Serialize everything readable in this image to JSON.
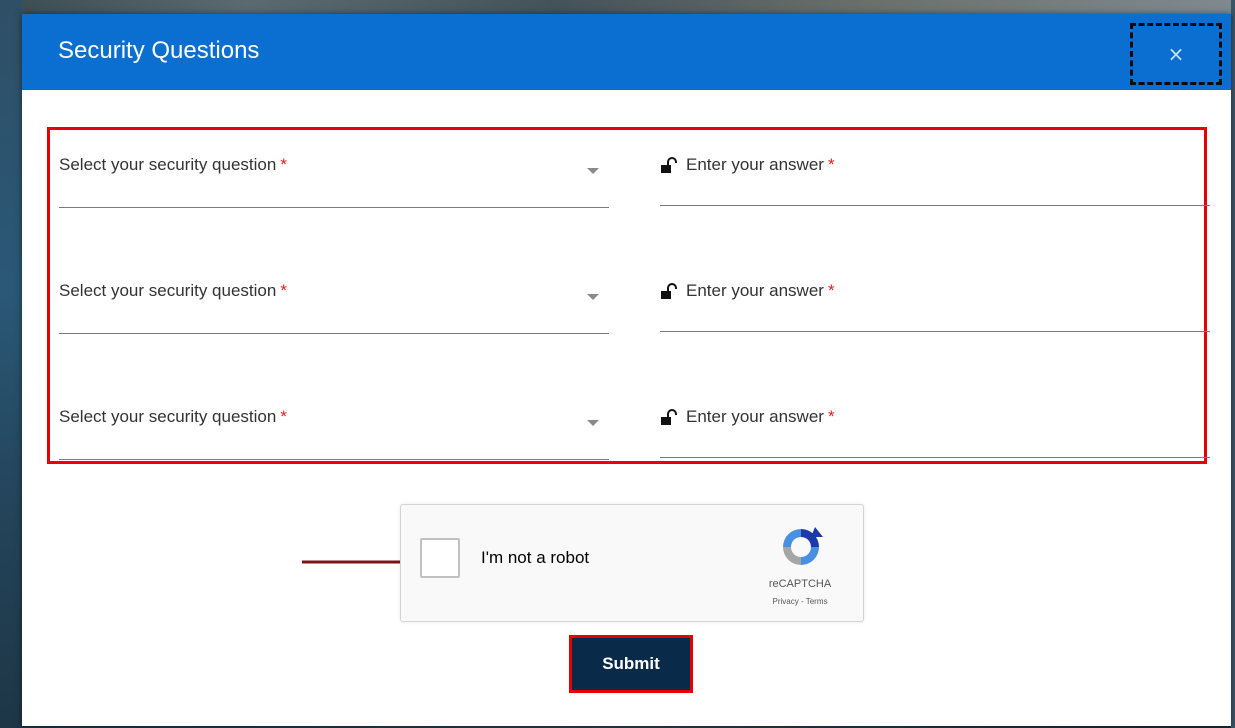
{
  "dialog": {
    "title": "Security Questions",
    "close_label": "×"
  },
  "questions": [
    {
      "select_placeholder": "Select your security question",
      "answer_placeholder": "Enter your answer",
      "required_mark": "*"
    },
    {
      "select_placeholder": "Select your security question",
      "answer_placeholder": "Enter your answer",
      "required_mark": "*"
    },
    {
      "select_placeholder": "Select your security question",
      "answer_placeholder": "Enter your answer",
      "required_mark": "*"
    }
  ],
  "captcha": {
    "label": "I'm not a robot",
    "brand": "reCAPTCHA",
    "links": "Privacy - Terms",
    "checked": false
  },
  "submit": {
    "label": "Submit"
  },
  "colors": {
    "header": "#0a6fd0",
    "highlight": "#e60000",
    "submit_bg": "#0a2a4a",
    "required": "#e02020"
  },
  "icons": {
    "close": "close-icon",
    "lock": "unlock-icon",
    "caret": "chevron-down-icon",
    "recaptcha": "recaptcha-logo-icon",
    "arrow": "arrow-right-icon"
  }
}
